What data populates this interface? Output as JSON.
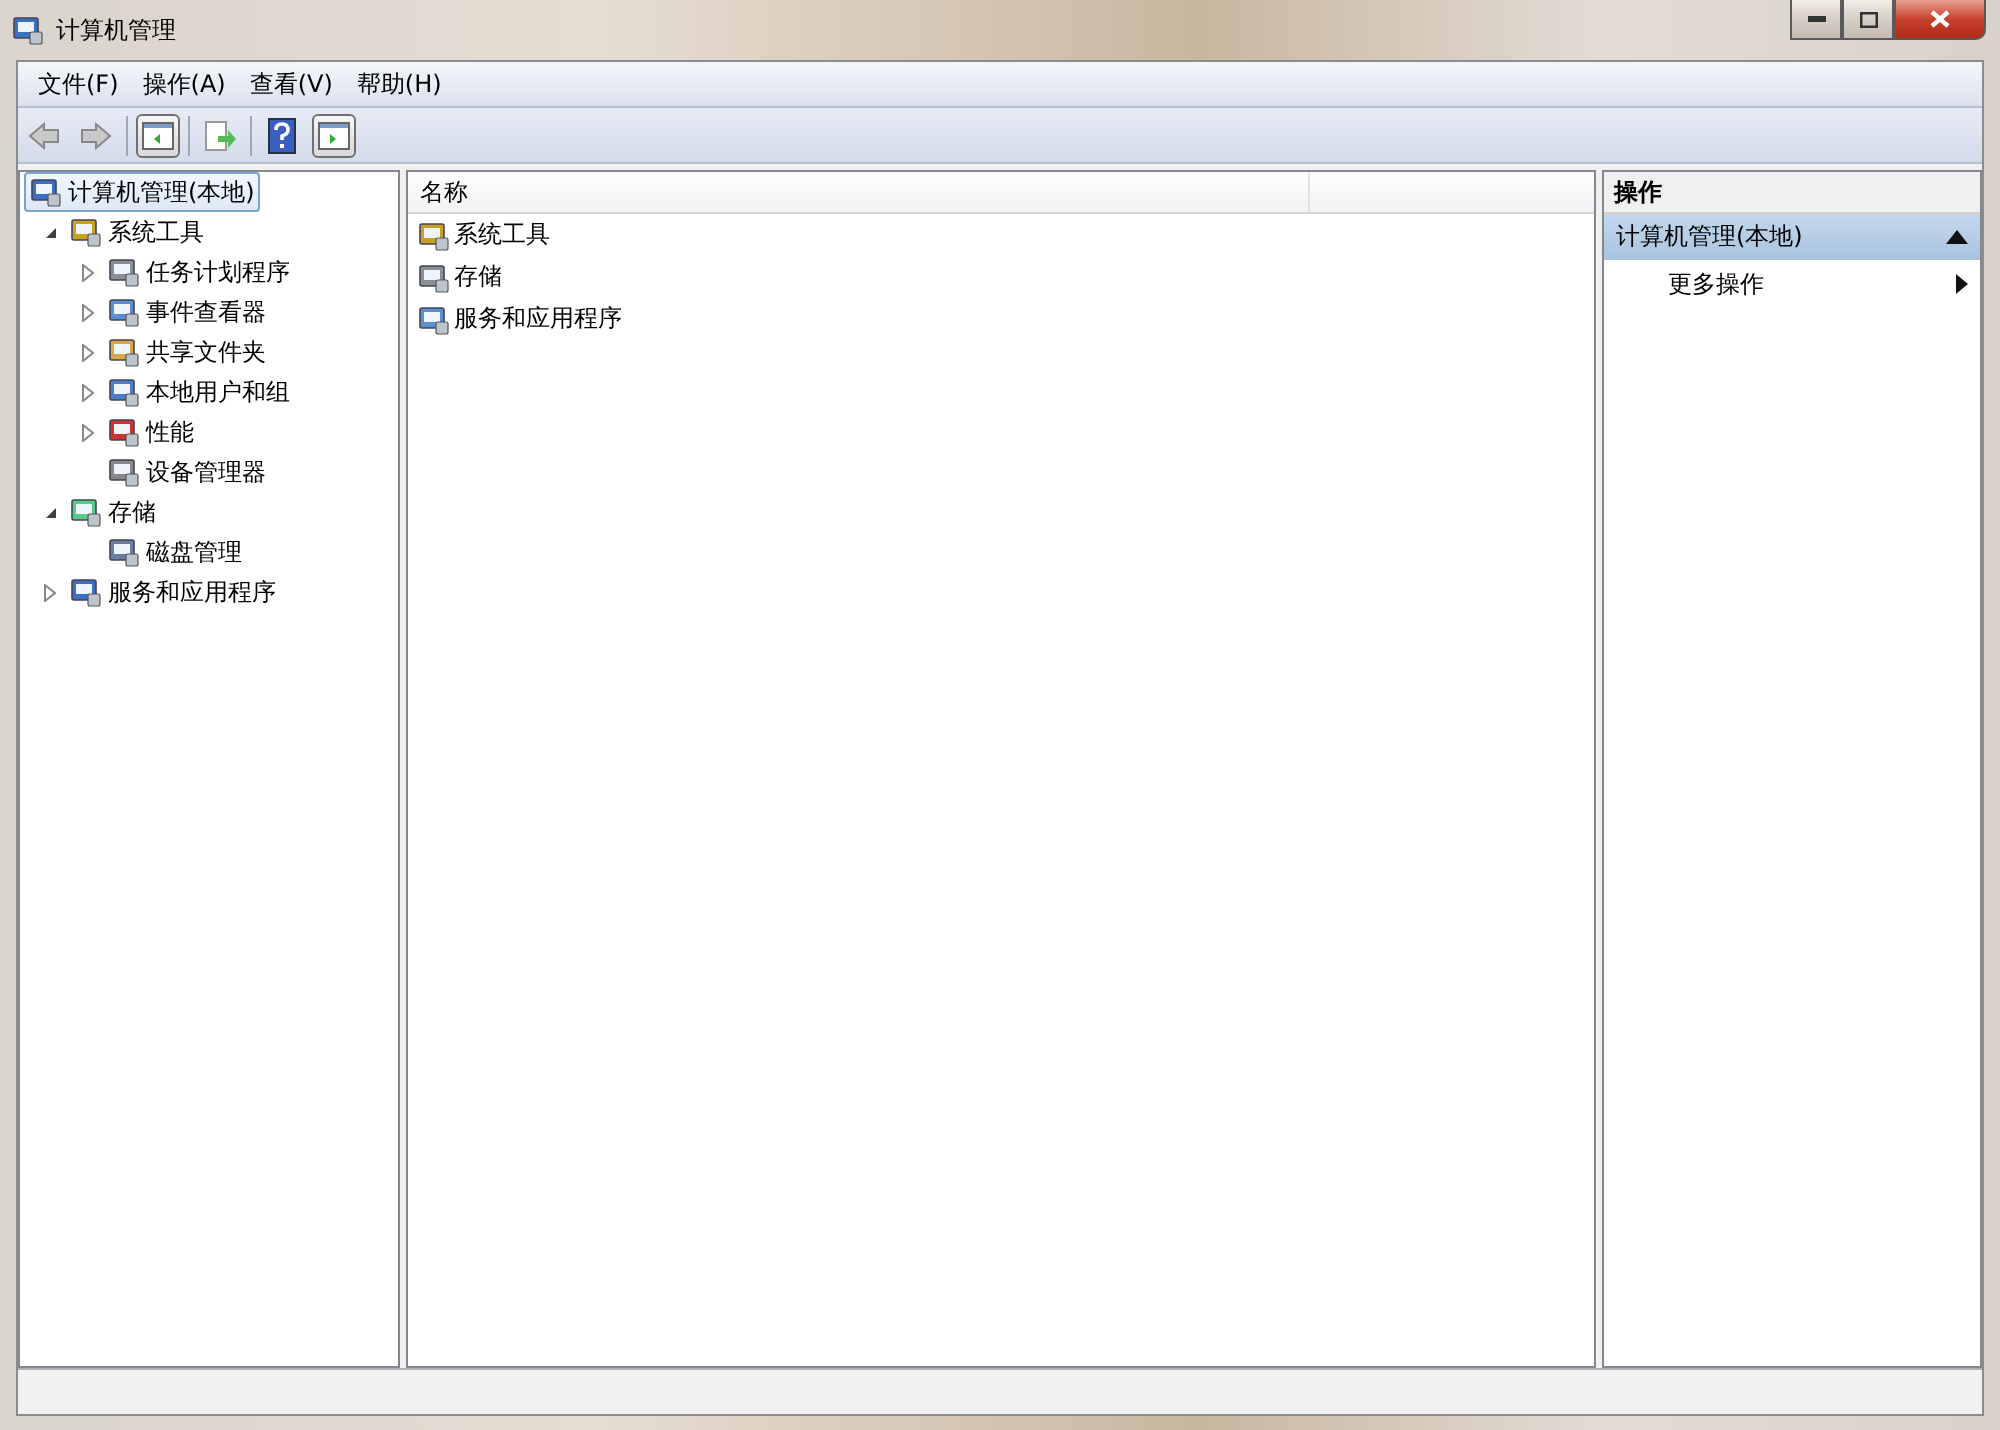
{
  "window": {
    "title": "计算机管理"
  },
  "menu": [
    "文件(F)",
    "操作(A)",
    "查看(V)",
    "帮助(H)"
  ],
  "tree": [
    {
      "label": "计算机管理(本地)",
      "selected": true,
      "kind": "root",
      "children": [
        {
          "label": "系统工具",
          "selected": false,
          "kind": "node",
          "expanded": true,
          "children": [
            {
              "label": "任务计划程序",
              "selected": false,
              "kind": "node",
              "expanded": false
            },
            {
              "label": "事件查看器",
              "selected": false,
              "kind": "node",
              "expanded": false
            },
            {
              "label": "共享文件夹",
              "selected": false,
              "kind": "node",
              "expanded": false
            },
            {
              "label": "本地用户和组",
              "selected": false,
              "kind": "node",
              "expanded": false
            },
            {
              "label": "性能",
              "selected": false,
              "kind": "node",
              "expanded": false
            },
            {
              "label": "设备管理器",
              "selected": false,
              "kind": "leaf"
            }
          ]
        },
        {
          "label": "存储",
          "selected": false,
          "kind": "node",
          "expanded": true,
          "children": [
            {
              "label": "磁盘管理",
              "selected": false,
              "kind": "leaf"
            }
          ]
        },
        {
          "label": "服务和应用程序",
          "selected": false,
          "kind": "node",
          "expanded": false
        }
      ]
    }
  ],
  "list": {
    "columns": [
      "名称"
    ],
    "rows": [
      "系统工具",
      "存储",
      "服务和应用程序"
    ]
  },
  "actions": {
    "header": "操作",
    "section": "计算机管理(本地)",
    "items": [
      "更多操作"
    ]
  }
}
